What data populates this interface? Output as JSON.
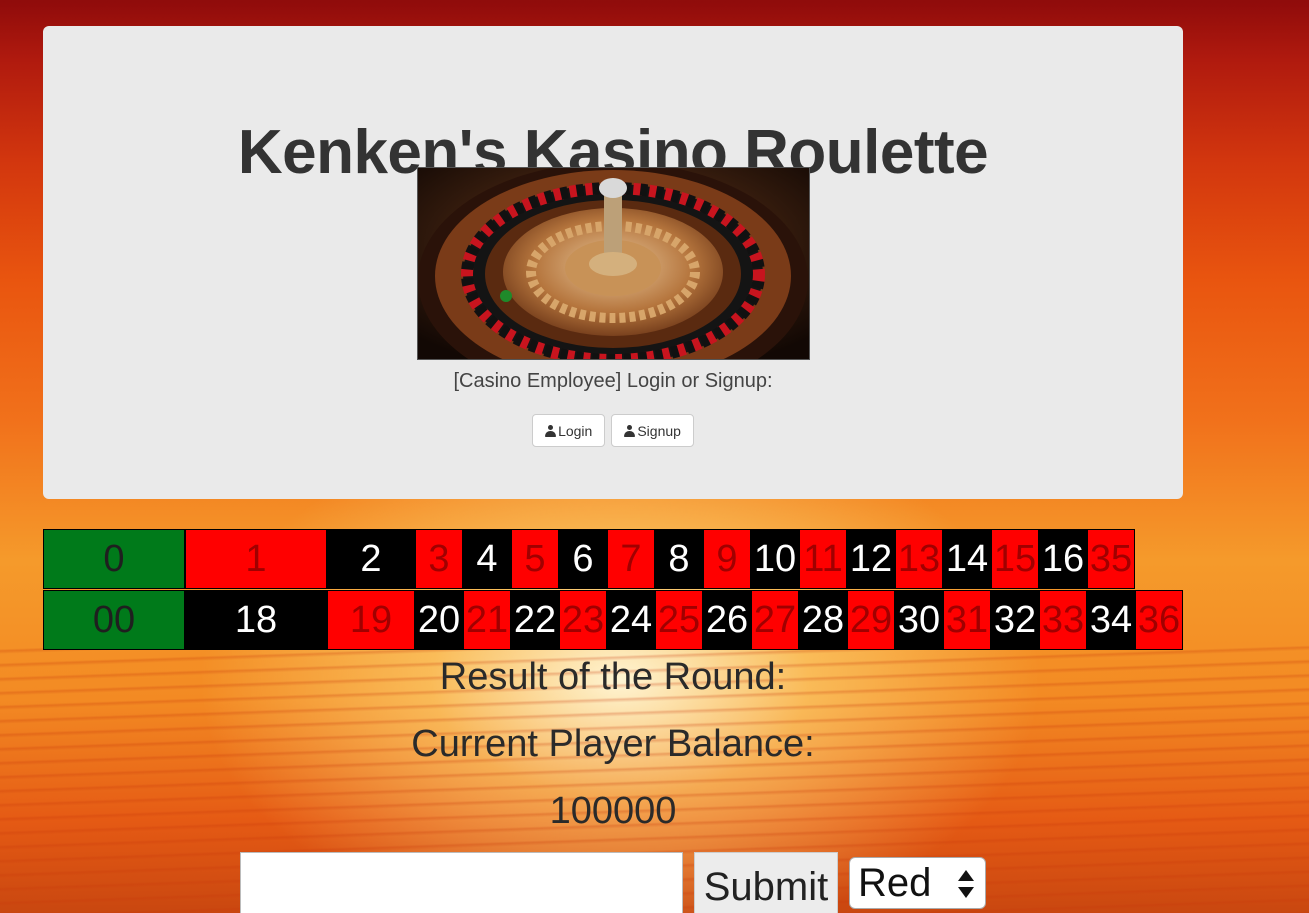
{
  "header": {
    "title": "Kenken's Kasino Roulette",
    "auth_prompt": "[Casino Employee] Login or Signup:",
    "login_label": "Login",
    "signup_label": "Signup"
  },
  "board": {
    "top_row": [
      {
        "n": "0",
        "color": "green"
      },
      {
        "n": "1",
        "color": "red"
      },
      {
        "n": "2",
        "color": "black"
      },
      {
        "n": "3",
        "color": "red"
      },
      {
        "n": "4",
        "color": "black"
      },
      {
        "n": "5",
        "color": "red"
      },
      {
        "n": "6",
        "color": "black"
      },
      {
        "n": "7",
        "color": "red"
      },
      {
        "n": "8",
        "color": "black"
      },
      {
        "n": "9",
        "color": "red"
      },
      {
        "n": "10",
        "color": "black"
      },
      {
        "n": "11",
        "color": "red"
      },
      {
        "n": "12",
        "color": "black"
      },
      {
        "n": "13",
        "color": "red"
      },
      {
        "n": "14",
        "color": "black"
      },
      {
        "n": "15",
        "color": "red"
      },
      {
        "n": "16",
        "color": "black"
      },
      {
        "n": "35",
        "color": "red"
      }
    ],
    "bottom_row": [
      {
        "n": "00",
        "color": "green"
      },
      {
        "n": "18",
        "color": "black"
      },
      {
        "n": "19",
        "color": "red"
      },
      {
        "n": "20",
        "color": "black"
      },
      {
        "n": "21",
        "color": "red"
      },
      {
        "n": "22",
        "color": "black"
      },
      {
        "n": "23",
        "color": "red"
      },
      {
        "n": "24",
        "color": "black"
      },
      {
        "n": "25",
        "color": "red"
      },
      {
        "n": "26",
        "color": "black"
      },
      {
        "n": "27",
        "color": "red"
      },
      {
        "n": "28",
        "color": "black"
      },
      {
        "n": "29",
        "color": "red"
      },
      {
        "n": "30",
        "color": "black"
      },
      {
        "n": "31",
        "color": "red"
      },
      {
        "n": "32",
        "color": "black"
      },
      {
        "n": "33",
        "color": "red"
      },
      {
        "n": "34",
        "color": "black"
      },
      {
        "n": "36",
        "color": "red"
      }
    ]
  },
  "info": {
    "result_label": "Result of the Round:",
    "balance_label": "Current Player Balance:",
    "balance_value": "100000"
  },
  "form": {
    "bet_value": "",
    "submit_label": "Submit",
    "color_selected": "Red"
  }
}
